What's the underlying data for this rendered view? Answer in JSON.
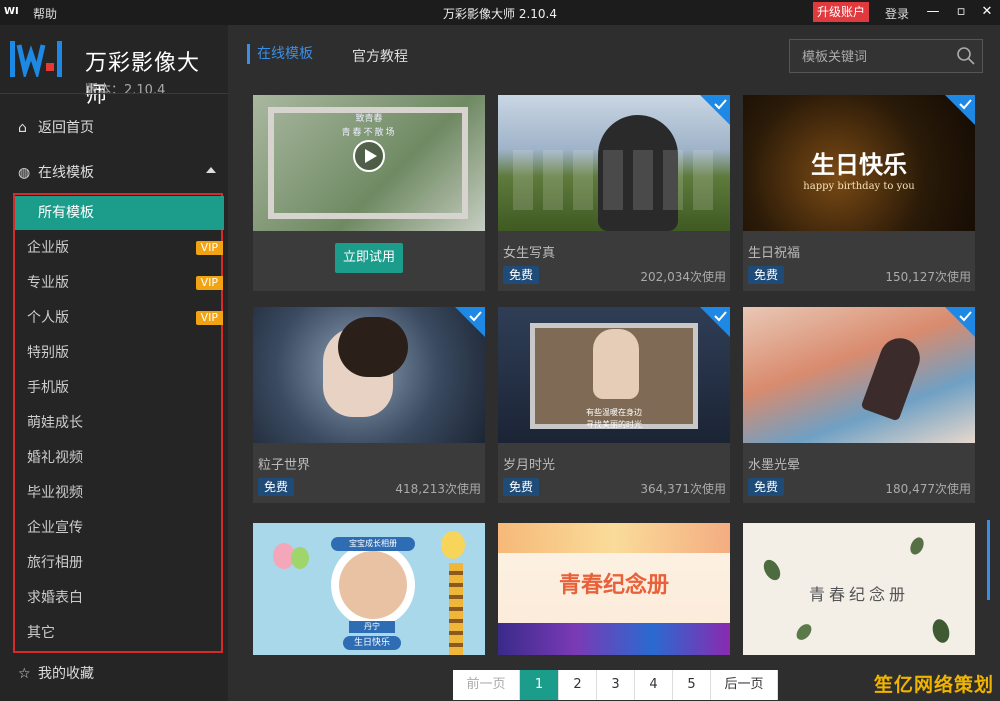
{
  "titlebar": {
    "logo": "WI",
    "help": "帮助",
    "title": "万彩影像大师 2.10.4",
    "upgrade": "升级账户",
    "login": "登录"
  },
  "brand": {
    "name": "万彩影像大师",
    "version": "版本：2.10.4"
  },
  "sidebar": {
    "home": "返回首页",
    "online": "在线模板",
    "favorites": "我的收藏",
    "items": [
      {
        "label": "所有模板",
        "vip": ""
      },
      {
        "label": "企业版",
        "vip": "VIP"
      },
      {
        "label": "专业版",
        "vip": "VIP"
      },
      {
        "label": "个人版",
        "vip": "VIP"
      },
      {
        "label": "特别版",
        "vip": ""
      },
      {
        "label": "手机版",
        "vip": ""
      },
      {
        "label": "萌娃成长",
        "vip": ""
      },
      {
        "label": "婚礼视频",
        "vip": ""
      },
      {
        "label": "毕业视频",
        "vip": ""
      },
      {
        "label": "企业宣传",
        "vip": ""
      },
      {
        "label": "旅行相册",
        "vip": ""
      },
      {
        "label": "求婚表白",
        "vip": ""
      },
      {
        "label": "其它",
        "vip": ""
      }
    ]
  },
  "tabs": {
    "online": "在线模板",
    "tutorial": "官方教程"
  },
  "search": {
    "placeholder": "模板关键词"
  },
  "cards": [
    {
      "title": "",
      "try": "立即试用",
      "thumb_text1": "致青春",
      "thumb_text2": "青春不散场"
    },
    {
      "title": "女生写真",
      "badge": "免费",
      "uses": "202,034次使用"
    },
    {
      "title": "生日祝福",
      "badge": "免费",
      "uses": "150,127次使用",
      "thumb_text1": "生日快乐",
      "thumb_text2": "happy birthday to you"
    },
    {
      "title": "粒子世界",
      "badge": "免费",
      "uses": "418,213次使用"
    },
    {
      "title": "岁月时光",
      "badge": "免费",
      "uses": "364,371次使用",
      "thumb_text1": "有些温暖在身边",
      "thumb_text2": "寻找美丽的时光"
    },
    {
      "title": "水墨光晕",
      "badge": "免费",
      "uses": "180,477次使用"
    },
    {
      "title": "",
      "thumb_text1": "宝宝成长相册",
      "thumb_text2": "生日快乐",
      "thumb_text3": "丹宁"
    },
    {
      "title": "",
      "thumb_text1": "青春纪念册"
    },
    {
      "title": "",
      "thumb_text1": "青春纪念册"
    }
  ],
  "pager": {
    "prev": "前一页",
    "pages": [
      "1",
      "2",
      "3",
      "4",
      "5"
    ],
    "next": "后一页"
  },
  "watermark": "笙亿网络策划",
  "colors": {
    "accent": "#1c9d8c",
    "tab": "#3a8ee6",
    "vip": "#f2a314",
    "upgrade": "#e0393e",
    "highlight": "#d92a2a"
  }
}
